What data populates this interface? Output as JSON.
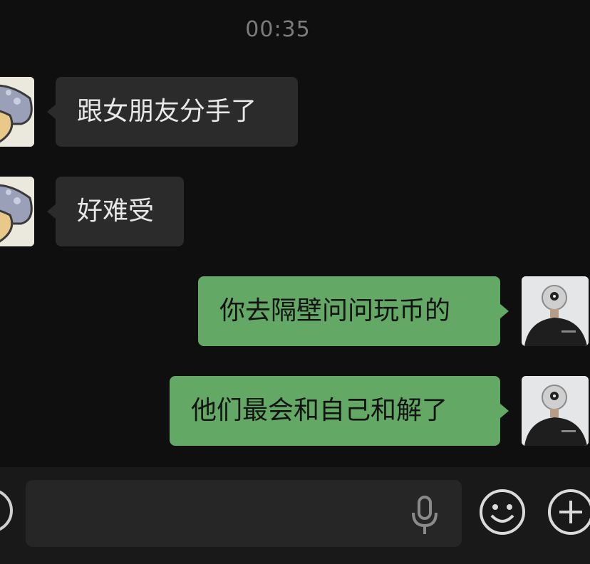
{
  "header": {
    "time": "00:35"
  },
  "messages": [
    {
      "side": "incoming",
      "text": "跟女朋友分手了"
    },
    {
      "side": "incoming",
      "text": "好难受"
    },
    {
      "side": "outgoing",
      "text": "你去隔壁问问玩币的"
    },
    {
      "side": "outgoing",
      "text": "他们最会和自己和解了"
    }
  ],
  "input_bar": {
    "value": "",
    "icons": [
      "voice-toggle-icon",
      "mic-icon",
      "emoji-icon",
      "plus-icon"
    ]
  },
  "colors": {
    "background": "#0f0f0f",
    "incoming_bubble": "#2b2b2b",
    "outgoing_bubble": "#64a865",
    "timestamp": "#7c7c7c"
  }
}
